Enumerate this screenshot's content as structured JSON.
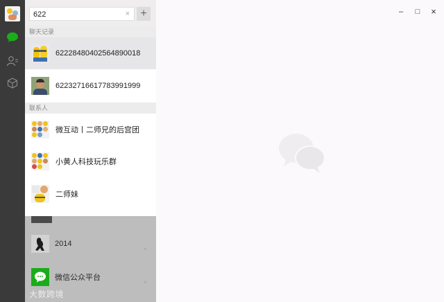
{
  "search": {
    "value": "622",
    "clear_label": "×",
    "add_label": "+"
  },
  "sections": {
    "chat_records_label": "聊天记录",
    "contacts_label": "联系人"
  },
  "chat_results": [
    {
      "name": "62228480402564890018",
      "icon": "minions-avatar"
    },
    {
      "name": "62232716617783991999",
      "icon": "person-photo-avatar"
    }
  ],
  "contact_results": [
    {
      "name": "微互动丨二师兄的后宫团",
      "icon": "group-avatar"
    },
    {
      "name": "小黄人科技玩乐群",
      "icon": "group-avatar"
    },
    {
      "name": "二师妹",
      "icon": "group-avatar"
    }
  ],
  "background_list": [
    {
      "name": "2014",
      "icon": "silhouette-avatar",
      "marker": "^"
    },
    {
      "name": "微信公众平台",
      "icon": "wechat-platform-avatar",
      "marker": "^"
    }
  ],
  "watermark": "大数跨境",
  "window_controls": {
    "minimize": "–",
    "maximize": "□",
    "close": "×"
  },
  "colors": {
    "rail": "#3a3a3a",
    "wechat_green": "#1aad19",
    "selected_row": "#e6e5e8"
  }
}
